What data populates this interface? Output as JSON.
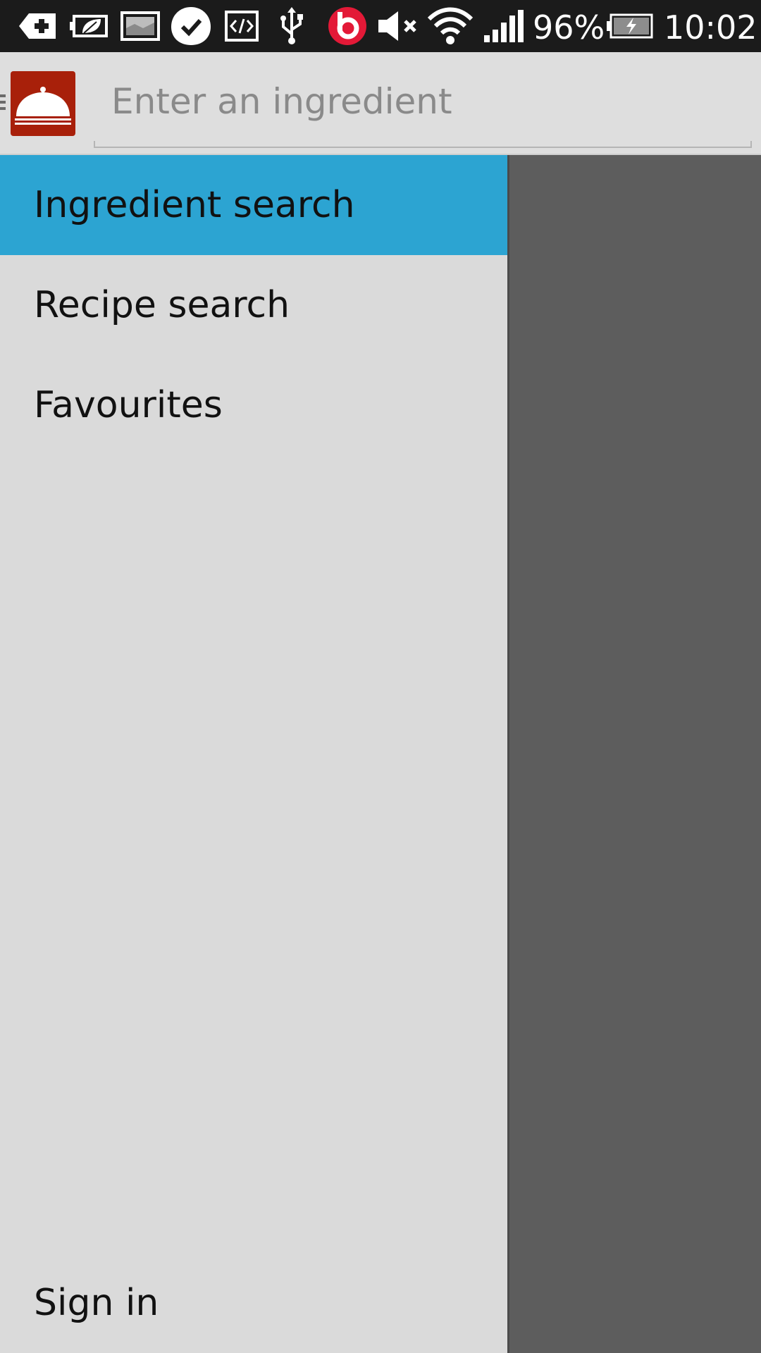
{
  "status_bar": {
    "battery_percent": "96%",
    "time": "10:02",
    "icons": [
      "hospital-cross-icon",
      "leaf-battery-icon",
      "image-icon",
      "check-bubble-icon",
      "code-icon",
      "usb-icon",
      "beats-icon",
      "mute-icon",
      "wifi-icon",
      "signal-icon",
      "battery-charging-icon"
    ]
  },
  "action_bar": {
    "search_placeholder": "Enter an ingredient",
    "logo_icon": "cloche-icon",
    "logo_color": "#a8200a"
  },
  "drawer": {
    "items": [
      {
        "label": "Ingredient search",
        "selected": true
      },
      {
        "label": "Recipe search",
        "selected": false
      },
      {
        "label": "Favourites",
        "selected": false
      }
    ],
    "footer_label": "Sign in",
    "selected_color": "#2ca4d2"
  }
}
